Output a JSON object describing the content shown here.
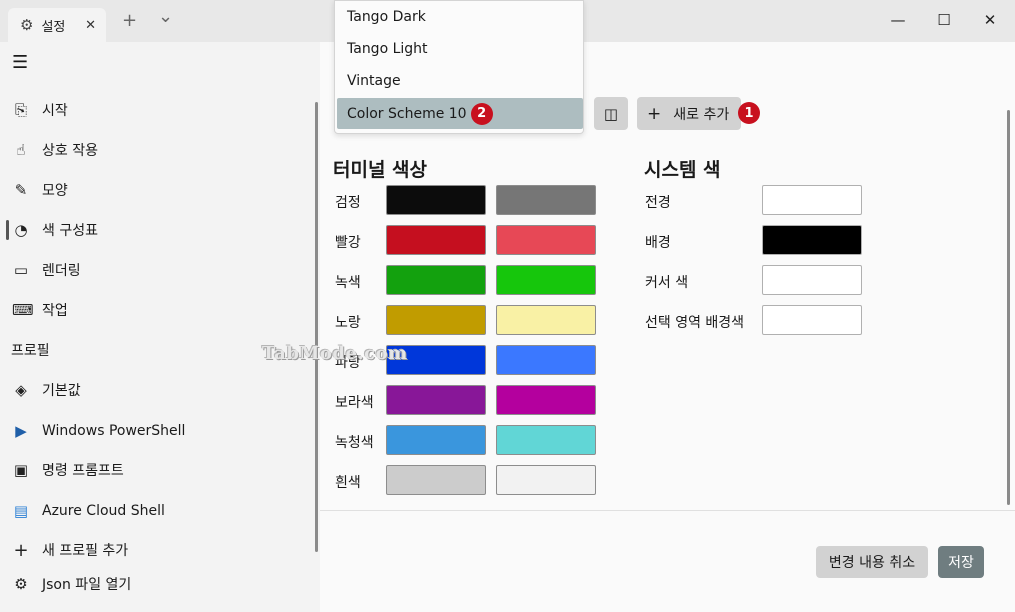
{
  "titlebar": {
    "tab_icon": "gear-icon",
    "tab_title": "설정",
    "close_glyph": "✕",
    "new_tab_glyph": "+",
    "dropdown_glyph": "⌄",
    "minimize_glyph": "—",
    "maximize_glyph": "☐",
    "close_window_glyph": "✕"
  },
  "sidebar": {
    "menu_glyph": "☰",
    "items": [
      {
        "label": "시작",
        "icon": "startup-icon",
        "glyph": "⎘"
      },
      {
        "label": "상호 작용",
        "icon": "interaction-icon",
        "glyph": "☝"
      },
      {
        "label": "모양",
        "icon": "brush-icon",
        "glyph": "✎"
      },
      {
        "label": "색 구성표",
        "icon": "palette-icon",
        "glyph": "◔"
      },
      {
        "label": "렌더링",
        "icon": "monitor-icon",
        "glyph": "▭"
      },
      {
        "label": "작업",
        "icon": "keyboard-icon",
        "glyph": "⌨"
      }
    ],
    "section_profiles": "프로필",
    "profiles": [
      {
        "label": "기본값",
        "icon": "layers-icon",
        "glyph": "◈"
      },
      {
        "label": "Windows PowerShell",
        "icon": "powershell-icon",
        "glyph": "▶"
      },
      {
        "label": "명령 프롬프트",
        "icon": "cmd-icon",
        "glyph": "▣"
      },
      {
        "label": "Azure Cloud Shell",
        "icon": "azure-icon",
        "glyph": "▤"
      },
      {
        "label": "새 프로필 추가",
        "icon": "plus-icon",
        "glyph": "+"
      },
      {
        "label": "Json 파일 열기",
        "icon": "gear-icon",
        "glyph": "⚙"
      }
    ]
  },
  "scheme_dropdown": {
    "options": [
      "Tango Dark",
      "Tango Light",
      "Vintage",
      "Color Scheme 10"
    ],
    "selected": "Color Scheme 10",
    "selected_badge": "2"
  },
  "toolbar": {
    "rename_icon": "book-icon",
    "rename_glyph": "◫",
    "add_glyph": "+",
    "add_label": "새로 추가",
    "add_badge": "1"
  },
  "terminal_colors": {
    "heading": "터미널 색상",
    "rows": [
      {
        "label": "검정",
        "normal": "#0c0c0c",
        "bright": "#767676"
      },
      {
        "label": "빨강",
        "normal": "#c50f1f",
        "bright": "#e74856"
      },
      {
        "label": "녹색",
        "normal": "#13a10e",
        "bright": "#16c60c"
      },
      {
        "label": "노랑",
        "normal": "#c19c00",
        "bright": "#f9f1a5"
      },
      {
        "label": "파랑",
        "normal": "#0037da",
        "bright": "#3b78ff"
      },
      {
        "label": "보라색",
        "normal": "#881798",
        "bright": "#b4009e"
      },
      {
        "label": "녹청색",
        "normal": "#3a96dd",
        "bright": "#61d6d6"
      },
      {
        "label": "흰색",
        "normal": "#cccccc",
        "bright": "#f2f2f2"
      }
    ]
  },
  "system_colors": {
    "heading": "시스템 색",
    "rows": [
      {
        "label": "전경",
        "color": "#ffffff"
      },
      {
        "label": "배경",
        "color": "#000000"
      },
      {
        "label": "커서 색",
        "color": "#ffffff"
      },
      {
        "label": "선택 영역 배경색",
        "color": "#ffffff"
      }
    ]
  },
  "footer": {
    "discard_label": "변경 내용 취소",
    "save_label": "저장"
  },
  "watermark": "TabMode.com"
}
